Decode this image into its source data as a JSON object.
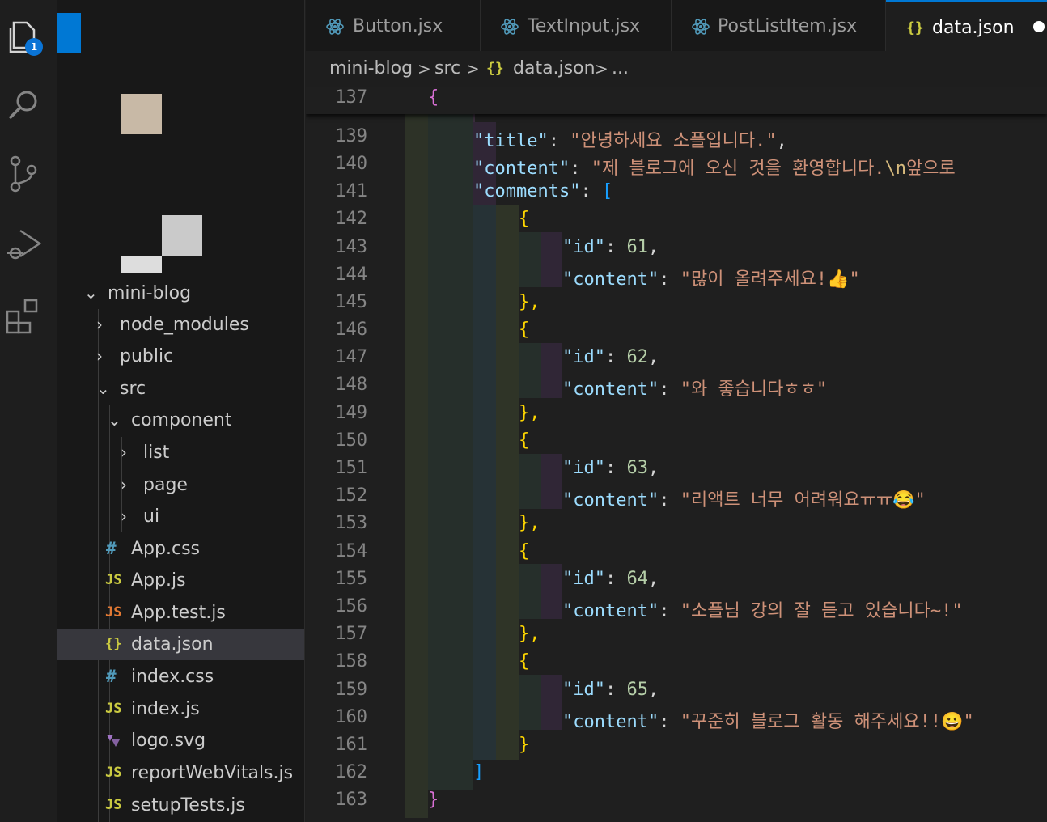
{
  "activity_bar": {
    "explorer_badge": "1"
  },
  "explorer": {
    "root": "mini-blog",
    "items": [
      {
        "label": "node_modules"
      },
      {
        "label": "public"
      },
      {
        "label": "src"
      },
      {
        "label": "component"
      },
      {
        "label": "list"
      },
      {
        "label": "page"
      },
      {
        "label": "ui"
      },
      {
        "label": "App.css",
        "icon": "#"
      },
      {
        "label": "App.js",
        "icon": "JS"
      },
      {
        "label": "App.test.js",
        "icon": "JS"
      },
      {
        "label": "data.json",
        "icon": "{}"
      },
      {
        "label": "index.css",
        "icon": "#"
      },
      {
        "label": "index.js",
        "icon": "JS"
      },
      {
        "label": "logo.svg"
      },
      {
        "label": "reportWebVitals.js",
        "icon": "JS"
      },
      {
        "label": "setupTests.js",
        "icon": "JS"
      }
    ]
  },
  "tabs": [
    {
      "label": "Button.jsx"
    },
    {
      "label": "TextInput.jsx"
    },
    {
      "label": "PostListItem.jsx"
    },
    {
      "label": "data.json",
      "icon": "{}"
    }
  ],
  "breadcrumb": {
    "folder": "mini-blog",
    "sep": ">",
    "sub": "src",
    "file_icon": "{}",
    "file": "data.json",
    "more": "..."
  },
  "editor": {
    "sticky": {
      "num": "137",
      "text": "{"
    },
    "lines": [
      {
        "num": "139",
        "key": "\"title\"",
        "str": "\"안녕하세요 소플입니다.\"",
        "tail": ","
      },
      {
        "num": "140",
        "key": "\"content\"",
        "str": "\"제 블로그에 오신 것을 환영합니다.",
        "esc": "\\n",
        "str2": "앞으로"
      },
      {
        "num": "141",
        "key": "\"comments\"",
        "open": "["
      },
      {
        "num": "142",
        "brace": "{"
      },
      {
        "num": "143",
        "key": "\"id\"",
        "num_val": "61",
        "tail": ","
      },
      {
        "num": "144",
        "key": "\"content\"",
        "str": "\"많이 올려주세요!👍\""
      },
      {
        "num": "145",
        "brace": "},"
      },
      {
        "num": "146",
        "brace": "{"
      },
      {
        "num": "147",
        "key": "\"id\"",
        "num_val": "62",
        "tail": ","
      },
      {
        "num": "148",
        "key": "\"content\"",
        "str": "\"와 좋습니다ㅎㅎ\""
      },
      {
        "num": "149",
        "brace": "},"
      },
      {
        "num": "150",
        "brace": "{"
      },
      {
        "num": "151",
        "key": "\"id\"",
        "num_val": "63",
        "tail": ","
      },
      {
        "num": "152",
        "key": "\"content\"",
        "str": "\"리액트 너무 어려워요ㅠㅠ😂\""
      },
      {
        "num": "153",
        "brace": "},"
      },
      {
        "num": "154",
        "brace": "{"
      },
      {
        "num": "155",
        "key": "\"id\"",
        "num_val": "64",
        "tail": ","
      },
      {
        "num": "156",
        "key": "\"content\"",
        "str": "\"소플님 강의 잘 듣고 있습니다~!\""
      },
      {
        "num": "157",
        "brace": "},"
      },
      {
        "num": "158",
        "brace": "{"
      },
      {
        "num": "159",
        "key": "\"id\"",
        "num_val": "65",
        "tail": ","
      },
      {
        "num": "160",
        "key": "\"content\"",
        "str": "\"꾸준히 블로그 활동 해주세요!!😀\""
      },
      {
        "num": "161",
        "brace": "}"
      },
      {
        "num": "162",
        "close": "]"
      },
      {
        "num": "163",
        "end": "}"
      }
    ]
  },
  "colors": {
    "accent": "#0078d4",
    "key": "#9cdcfe",
    "string": "#ce9178",
    "number": "#b5cea8",
    "bracket_gold": "#ffd700",
    "bracket_purple": "#da70d6",
    "bracket_blue": "#179fff"
  }
}
